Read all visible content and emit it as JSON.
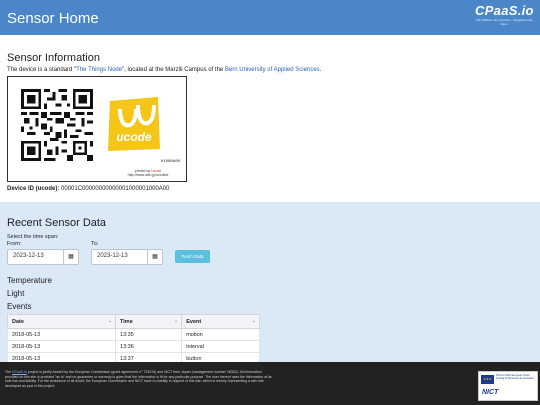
{
  "header": {
    "title": "Sensor Home",
    "logo_text": "CPaaS.io",
    "logo_tagline": "City Platform as a Service - Integrated and Open"
  },
  "sensor_info": {
    "title": "Sensor Information",
    "text_prefix": "The device is a standard \"",
    "device_link": "The Things Node",
    "text_middle": "\", located at the Marzili Campus of the ",
    "campus_link": "Bern University of Applied Sciences",
    "text_suffix": ".",
    "tag": {
      "logo_text": "ucode",
      "serial": "01000A00",
      "printed_by_prefix": "printed by ",
      "printed_by_name": "Ucode",
      "url": "http://www.ubin.jp/ucodeid"
    },
    "device_id_label": "Device ID (ucode):",
    "device_id_value": "00001C00000000000001000001000A00"
  },
  "recent": {
    "title": "Recent Sensor Data",
    "span_label": "Select the time span:",
    "from_label": "From:",
    "to_label": "To:",
    "from_value": "2023-12-13",
    "to_value": "2023-12-13",
    "fetch_label": "Fetch Data",
    "links": [
      "Temperature",
      "Light",
      "Events"
    ],
    "table": {
      "headers": [
        "Date",
        "Time",
        "Event"
      ],
      "rows": [
        [
          "2018-05-13",
          "13:35",
          "motion"
        ],
        [
          "2018-05-13",
          "13:36",
          "interval"
        ],
        [
          "2018-05-13",
          "13:37",
          "button"
        ]
      ]
    }
  },
  "footer": {
    "prefix": "The ",
    "link": "CPaaS.io",
    "text": " project is jointly funded by the European Commission (grant agreement n° 723076) and NICT from Japan (management number 18302). All information provided on this site is provided \"as is\" and no guarantee or warranty is given that the information is fit for any particular purpose. The user thereof uses the information at its sole risk and liability. For the avoidance of all doubt, the European Commission and NICT have no liability in respect of this site, which is merely representing a web site developed as part of the project.",
    "eu_text": "Horizon 2020 European Union funding for Research & Innovation",
    "nict_text": "NICT"
  }
}
